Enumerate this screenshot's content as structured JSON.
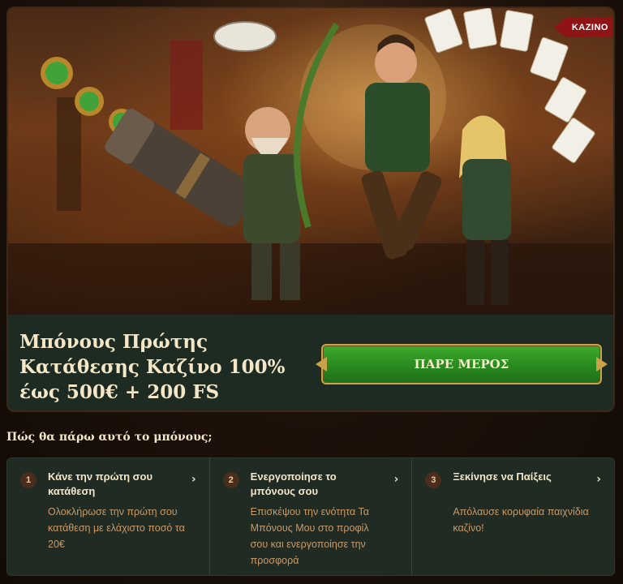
{
  "hero": {
    "badge": "ΚΑΖΙΝΟ",
    "illustration": "fantasy-heroes-casino-illustration"
  },
  "offer": {
    "title": "Μπόνους Πρώτης Κατάθεσης Καζίνο 100% έως 500€ + 200 FS",
    "cta_label": "ΠΑΡΕ ΜΕΡΟΣ"
  },
  "how": {
    "title": "Πώς θα πάρω αυτό το μπόνους;"
  },
  "steps": [
    {
      "number": "1",
      "title": "Κάνε την πρώτη σου κατάθεση",
      "description": "Ολοκλήρωσε την πρώτη σου κατάθεση με ελάχιστο ποσό τα 20€",
      "icon": "chevron-right-icon"
    },
    {
      "number": "2",
      "title": "Ενεργοποίησε το μπόνους σου",
      "description": "Επισκέψου την ενότητα Τα Μπόνους Μου στο προφίλ σου και ενεργοποίησε την προσφορά",
      "icon": "chevron-right-icon"
    },
    {
      "number": "3",
      "title": "Ξεκίνησε να Παίξεις",
      "description": "Απόλαυσε κορυφαία παιχνίδια καζίνο!",
      "icon": "chevron-right-icon"
    }
  ],
  "colors": {
    "accent_gold": "#c9a24a",
    "cta_green": "#2a8a1f",
    "badge_red": "#8e1416",
    "step_desc": "#c99a6a"
  }
}
